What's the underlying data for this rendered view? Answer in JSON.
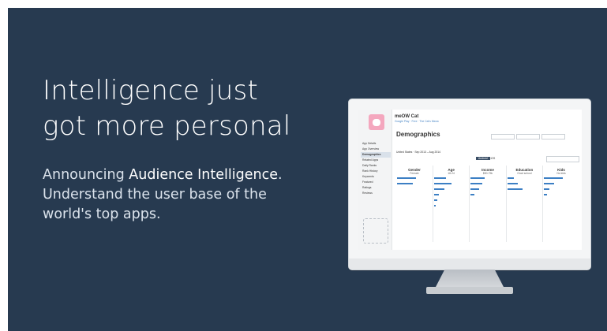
{
  "headline": {
    "line1": "Intelligence just",
    "line2": "got more personal"
  },
  "announcement": {
    "prefix": "Announcing ",
    "product": "Audience Intelligence",
    "suffix": ".",
    "line2": "Understand the user base of the",
    "line3": "world's top apps."
  },
  "screen": {
    "app_name": "meOW Cat",
    "app_meta": "Google Play · Free · The Cat's Meow",
    "section_title": "Demographics",
    "filter_range": "United States · Sep 2013 – Aug 2014",
    "tab_active": "Android",
    "tab_other": "iOS",
    "sidebar_items": [
      "App Details",
      "App Overview",
      "Demographics",
      "Related Apps",
      "Daily Ranks",
      "Rank History",
      "Keywords",
      "Featured",
      "Ratings",
      "Reviews"
    ],
    "columns": [
      {
        "title": "Gender",
        "value": "Female",
        "bars": [
          0.55,
          0.45
        ]
      },
      {
        "title": "Age",
        "value": "18-24",
        "bars": [
          0.35,
          0.5,
          0.3,
          0.15,
          0.1,
          0.05
        ]
      },
      {
        "title": "Income",
        "value": "$50-75k",
        "bars": [
          0.4,
          0.35,
          0.25,
          0.1
        ]
      },
      {
        "title": "Education",
        "value": "Grad school",
        "bars": [
          0.2,
          0.3,
          0.45
        ]
      },
      {
        "title": "Kids",
        "value": "No kids",
        "bars": [
          0.55,
          0.3,
          0.15,
          0.1
        ]
      }
    ]
  }
}
